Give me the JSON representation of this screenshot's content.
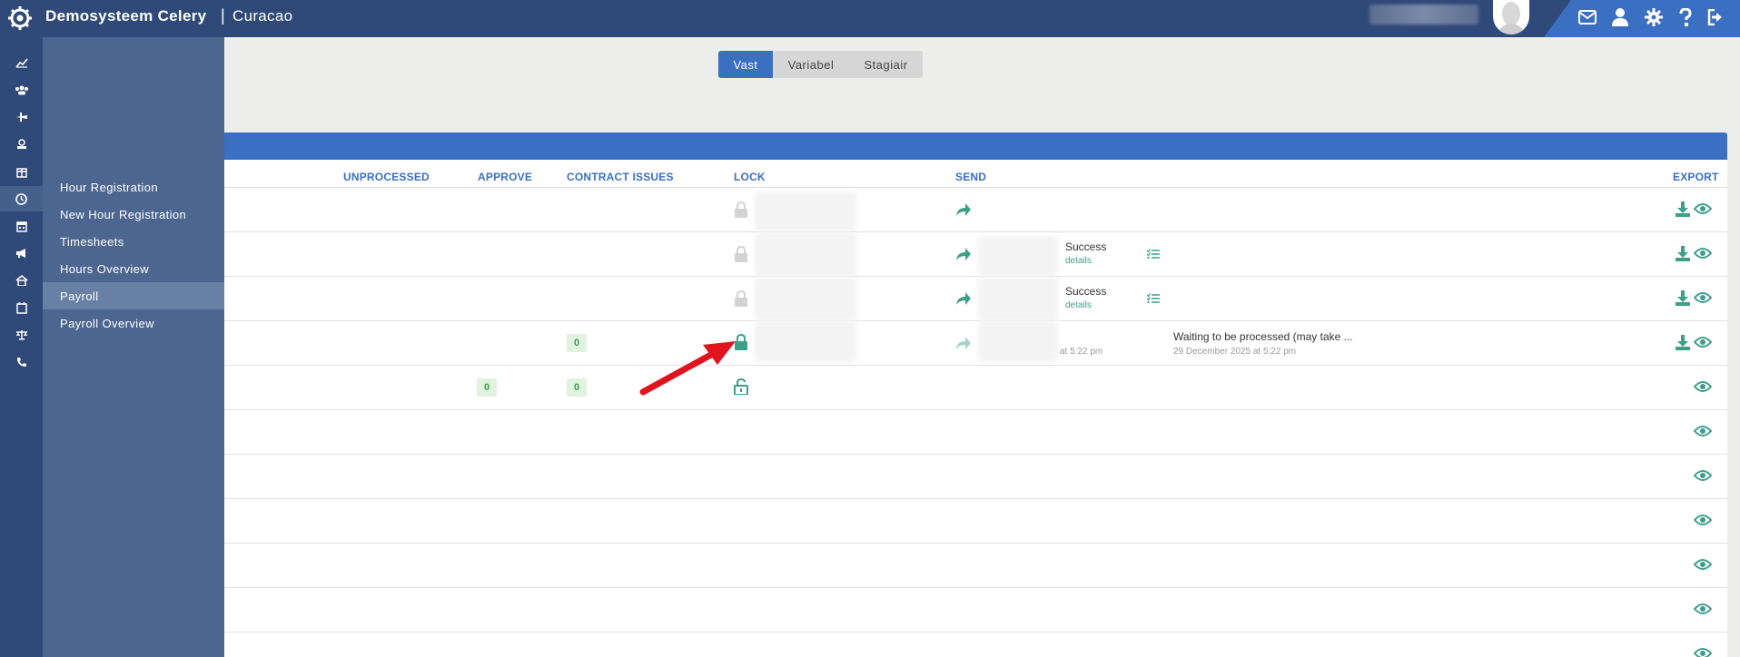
{
  "app": {
    "title": "Demosysteem Celery",
    "separator": "|",
    "subtitle": "Curacao"
  },
  "submenu": {
    "items": [
      {
        "label": "Hour Registration"
      },
      {
        "label": "New Hour Registration"
      },
      {
        "label": "Timesheets"
      },
      {
        "label": "Hours Overview"
      },
      {
        "label": "Payroll"
      },
      {
        "label": "Payroll Overview"
      }
    ]
  },
  "tabs": [
    {
      "label": "Vast"
    },
    {
      "label": "Variabel"
    },
    {
      "label": "Stagiair"
    }
  ],
  "table": {
    "headers": {
      "unprocessed": "UNPROCESSED",
      "approve": "APPROVE",
      "contract_issues": "CONTRACT ISSUES",
      "lock": "LOCK",
      "send": "SEND",
      "export": "EXPORT"
    },
    "rows": [
      {},
      {
        "send_status": "Success",
        "send_link": "details"
      },
      {
        "send_status": "Success",
        "send_link": "details"
      },
      {
        "contract_issues": "0",
        "send_date_partial": "at 5:22 pm",
        "process_status": "Waiting to be processed (may take ...",
        "process_date": "29 December 2025 at 5:22 pm"
      },
      {
        "approve": "0",
        "contract_issues": "0"
      }
    ]
  },
  "colors": {
    "topbar": "#2f4a78",
    "accent": "#3b6fc2",
    "teal": "#3d9f8a",
    "badge_bg": "#dff3df",
    "arrow": "#e0141e"
  }
}
